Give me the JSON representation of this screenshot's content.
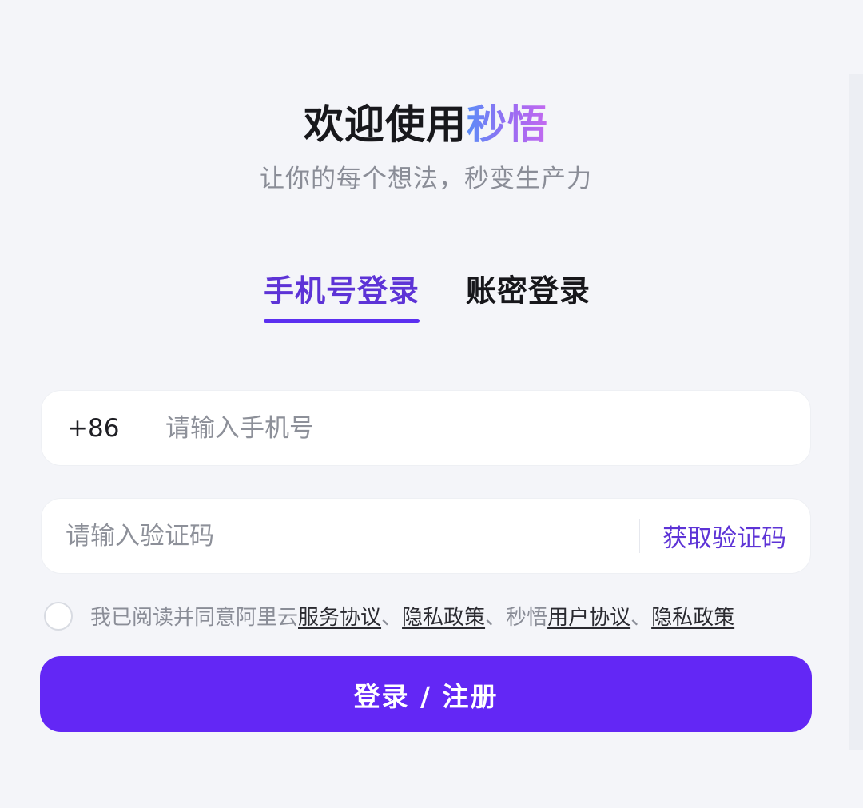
{
  "header": {
    "title_prefix": "欢迎使用",
    "title_brand": "秒悟",
    "subtitle": "让你的每个想法，秒变生产力"
  },
  "tabs": [
    {
      "label": "手机号登录",
      "active": true
    },
    {
      "label": "账密登录",
      "active": false
    }
  ],
  "phone_field": {
    "prefix": "+86",
    "value": "",
    "placeholder": "请输入手机号"
  },
  "code_field": {
    "value": "",
    "placeholder": "请输入验证码",
    "get_code_label": "获取验证码"
  },
  "agreement": {
    "checked": false,
    "text_prefix": "我已阅读并同意阿里云",
    "link_1": "服务协议",
    "sep_1": "、",
    "link_2": "隐私政策",
    "mid_text": "、秒悟",
    "link_3": "用户协议",
    "sep_2": "、",
    "link_4": "隐私政策"
  },
  "submit": {
    "label": "登录 / 注册"
  },
  "colors": {
    "accent": "#6327f5",
    "tab_active": "#5d33d6",
    "background": "#f4f5f9"
  }
}
